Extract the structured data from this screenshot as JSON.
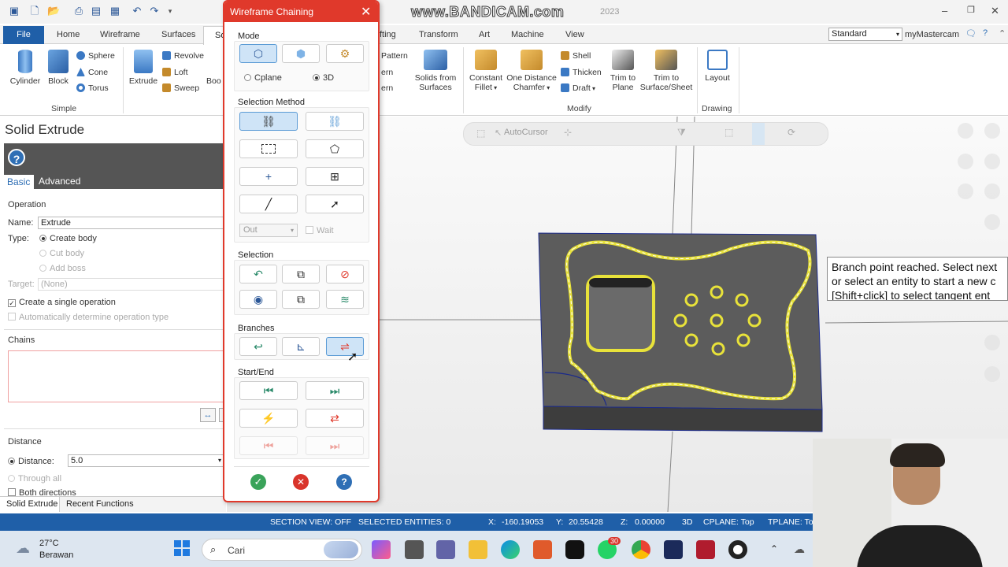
{
  "watermark": "www.BANDICAM.com",
  "watermark_year": "2023",
  "ribbon_tabs": {
    "file": "File",
    "home": "Home",
    "wireframe": "Wireframe",
    "surfaces": "Surfaces",
    "solids": "So",
    "drafting": "fting",
    "transform": "Transform",
    "art": "Art",
    "machine": "Machine",
    "view": "View"
  },
  "standard_select": "Standard",
  "my_mastercam": "myMastercam",
  "ribbon": {
    "cylinder": "Cylinder",
    "block": "Block",
    "sphere": "Sphere",
    "cone": "Cone",
    "torus": "Torus",
    "simple_label": "Simple",
    "extrude": "Extrude",
    "revolve": "Revolve",
    "loft": "Loft",
    "sweep": "Sweep",
    "boo": "Boo",
    "pattern": "Pattern",
    "ern1": "ern",
    "ern2": "ern",
    "solids_from_surfaces_1": "Solids from",
    "solids_from_surfaces_2": "Surfaces",
    "constant_fillet_1": "Constant",
    "constant_fillet_2": "Fillet",
    "one_distance_chamfer_1": "One Distance",
    "one_distance_chamfer_2": "Chamfer",
    "shell": "Shell",
    "thicken": "Thicken",
    "draft": "Draft",
    "trim_to_plane_1": "Trim to",
    "trim_to_plane_2": "Plane",
    "trim_to_surface_1": "Trim to",
    "trim_to_surface_2": "Surface/Sheet",
    "modify_label": "Modify",
    "layout": "Layout",
    "drawing_label": "Drawing"
  },
  "left_panel": {
    "title": "Solid Extrude",
    "tab_basic": "Basic",
    "tab_advanced": "Advanced",
    "operation_label": "Operation",
    "name_label": "Name:",
    "name_value": "Extrude",
    "type_label": "Type:",
    "type_create": "Create body",
    "type_cut": "Cut body",
    "type_boss": "Add boss",
    "target_label": "Target:",
    "target_value": "(None)",
    "single_op": "Create a single operation",
    "auto_type": "Automatically determine operation type",
    "chains_label": "Chains",
    "distance_section": "Distance",
    "distance_label": "Distance:",
    "distance_value": "5.0",
    "through_all": "Through all",
    "both_directions": "Both directions",
    "bottom_tab_1": "Solid Extrude",
    "bottom_tab_2": "Recent Functions"
  },
  "dialog": {
    "title": "Wireframe Chaining",
    "mode_label": "Mode",
    "cplane": "Cplane",
    "three_d": "3D",
    "selection_method_label": "Selection Method",
    "out_value": "Out",
    "wait": "Wait",
    "selection_label": "Selection",
    "branches_label": "Branches",
    "start_end_label": "Start/End"
  },
  "viewport": {
    "autocursor": "AutoCursor",
    "tooltip_line1": "Branch point reached. Select next",
    "tooltip_line2": "or select an entity to start a new c",
    "tooltip_line3": "[Shift+click] to select tangent ent"
  },
  "status_bar": {
    "section_view": "SECTION VIEW: OFF",
    "selected_entities": "SELECTED ENTITIES: 0",
    "x_label": "X:",
    "x_value": "-160.19053",
    "y_label": "Y:",
    "y_value": "20.55428",
    "z_label": "Z:",
    "z_value": "0.00000",
    "mode": "3D",
    "cplane": "CPLANE: Top",
    "tplane": "TPLANE: Top"
  },
  "taskbar": {
    "temperature": "27°C",
    "weather": "Berawan",
    "search_placeholder": "Cari",
    "whatsapp_badge": "30"
  },
  "colors": {
    "accent": "#1f5fa8",
    "dialog_red": "#e0392b",
    "chain_yellow": "#e8e23a"
  }
}
